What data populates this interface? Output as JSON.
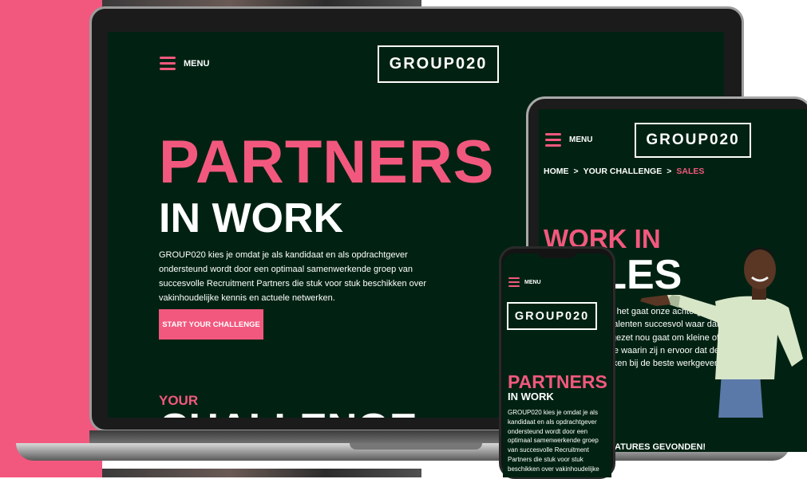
{
  "colors": {
    "accent": "#f2587e",
    "screen_bg": "#012212",
    "text": "#ffffff"
  },
  "laptop": {
    "menu_label": "MENU",
    "logo": "GROUP020",
    "title_line1": "PARTNERS",
    "title_line2": "IN WORK",
    "body": "GROUP020 kies je omdat je als kandidaat en als opdrachtgever ondersteund wordt door een optimaal samenwerkende groep van succesvolle Recruitment Partners die stuk voor stuk beschikken over vakinhoudelijke kennis en actuele netwerken.",
    "cta": "START YOUR CHALLENGE",
    "section_kicker": "YOUR",
    "section_title": "CHALLENGE"
  },
  "tablet": {
    "menu_label": "MENU",
    "logo": "GROUP020",
    "breadcrumb": [
      "HOME",
      ">",
      "YOUR CHALLENGE",
      ">",
      "SALES"
    ],
    "title_line1": "WORK IN",
    "title_line2": "SALES",
    "body": "wij praten als het gaat onze achtergrond weten erciële talenten succesvol waar dat het beste ingezet nou gaat om kleine of markt of branche waarin zij n ervoor dat de beste ken bij de beste werkgever.",
    "footer": "ATURES GEVONDEN!"
  },
  "phone": {
    "menu_label": "MENU",
    "logo": "GROUP020",
    "title_line1": "PARTNERS",
    "title_line2": "IN WORK",
    "body": "GROUP020 kies je omdat je als kandidaat en als opdrachtgever ondersteund wordt door een optimaal samenwerkende groep van succesvolle Recruitment Partners die stuk voor stuk beschikken over vakinhoudelijke"
  }
}
